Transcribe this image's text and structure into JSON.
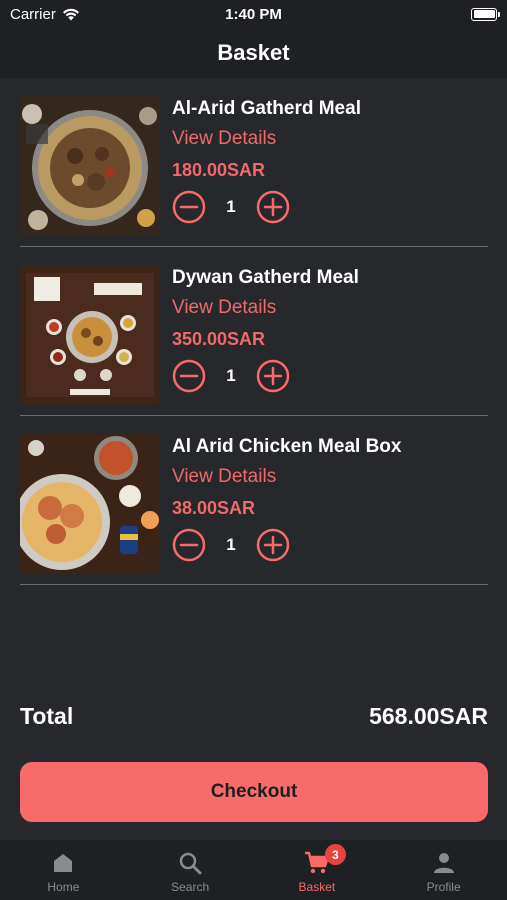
{
  "status": {
    "carrier": "Carrier",
    "time": "1:40 PM"
  },
  "header": {
    "title": "Basket"
  },
  "items": [
    {
      "name": "Al-Arid Gatherd Meal",
      "details": "View Details",
      "price": "180.00SAR",
      "quantity": "1"
    },
    {
      "name": "Dywan Gatherd Meal",
      "details": "View Details",
      "price": "350.00SAR",
      "quantity": "1"
    },
    {
      "name": "Al Arid Chicken Meal Box",
      "details": "View Details",
      "price": "38.00SAR",
      "quantity": "1"
    }
  ],
  "summary": {
    "total_label": "Total",
    "total_value": "568.00SAR"
  },
  "checkout": {
    "label": "Checkout"
  },
  "tabs": [
    {
      "label": "Home",
      "icon": "home-icon",
      "active": false
    },
    {
      "label": "Search",
      "icon": "search-icon",
      "active": false
    },
    {
      "label": "Basket",
      "icon": "cart-icon",
      "active": true,
      "badge": "3"
    },
    {
      "label": "Profile",
      "icon": "person-icon",
      "active": false
    }
  ],
  "colors": {
    "accent": "#f76b6b",
    "background": "#27282c",
    "bar": "#1f2023",
    "badge": "#e9433f"
  }
}
